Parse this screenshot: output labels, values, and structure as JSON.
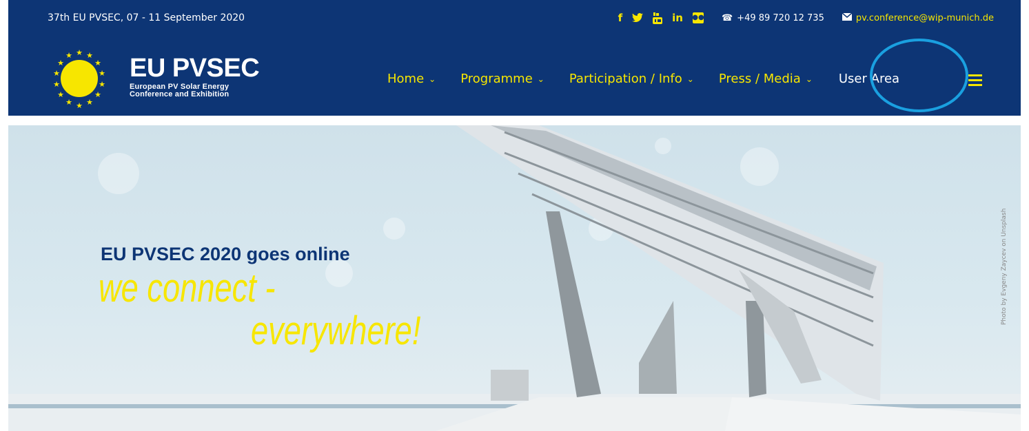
{
  "topbar": {
    "event_text": "37th EU PVSEC, 07 - 11 September 2020",
    "social_icons": [
      "facebook-icon",
      "twitter-icon",
      "youtube-icon",
      "linkedin-icon",
      "flickr-icon"
    ],
    "phone": "+49 89 720 12 735",
    "email": "pv.conference@wip-munich.de"
  },
  "logo": {
    "title": "EU PVSEC",
    "subtitle_line1": "European PV Solar Energy",
    "subtitle_line2": "Conference and Exhibition"
  },
  "nav": {
    "items": [
      {
        "label": "Home"
      },
      {
        "label": "Programme"
      },
      {
        "label": "Participation / Info"
      },
      {
        "label": "Press / Media"
      }
    ],
    "user_area": "User Area",
    "menu_icon": "hamburger-icon"
  },
  "hero": {
    "title": "EU PVSEC 2020 goes online",
    "line1": "we connect -",
    "line2": "everywhere!",
    "credit": "Photo by Evgeny Zaycev on Unsplash"
  },
  "colors": {
    "brand_blue": "#0d3575",
    "accent_yellow": "#f7e600",
    "highlight_circle": "#1aa0e0"
  }
}
